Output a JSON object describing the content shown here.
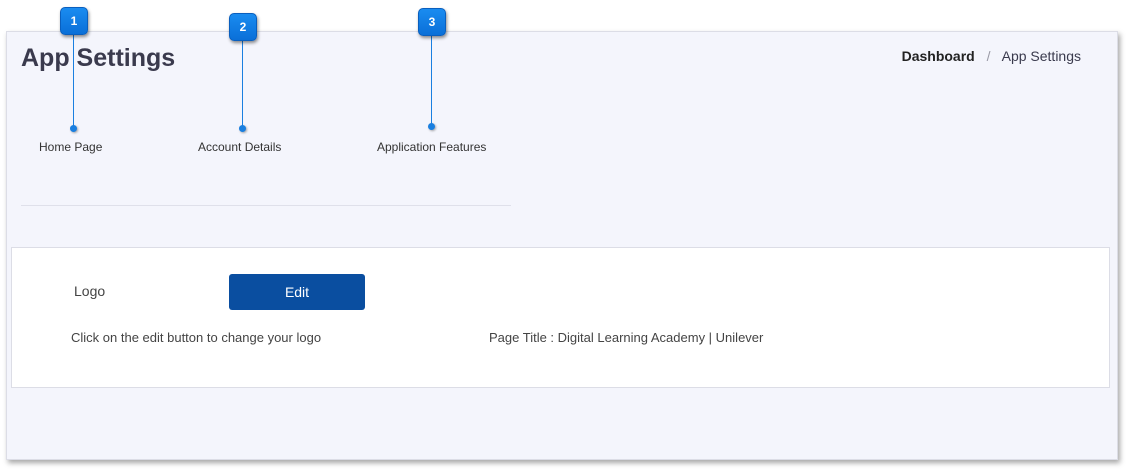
{
  "header": {
    "title": "App Settings",
    "breadcrumb": [
      "Dashboard",
      "App Settings"
    ],
    "breadcrumb_separator": "/"
  },
  "tabs": [
    {
      "label": "Home Page"
    },
    {
      "label": "Account Details"
    },
    {
      "label": "Application Features"
    }
  ],
  "callouts": [
    "1",
    "2",
    "3"
  ],
  "logo_section": {
    "label": "Logo",
    "edit_label": "Edit",
    "help_text": "Click on the edit button to change your logo",
    "page_title_text": "Page Title : Digital Learning Academy | Unilever"
  },
  "colors": {
    "accent": "#0a4ea0",
    "callout": "#1a7fe0",
    "panel_bg": "#f4f5fc"
  }
}
